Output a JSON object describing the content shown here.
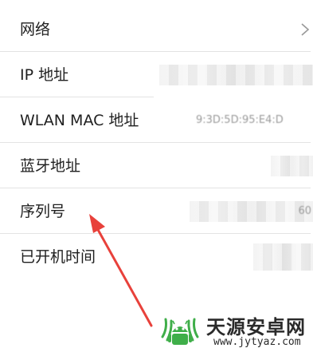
{
  "settings_rows": [
    {
      "label": "网络"
    },
    {
      "label": "IP 地址"
    },
    {
      "label": "WLAN MAC 地址",
      "visible_fragment": "9:3D:5D:95:E4:D"
    },
    {
      "label": "蓝牙地址"
    },
    {
      "label": "序列号",
      "visible_fragment": "60"
    },
    {
      "label": "已开机时间"
    }
  ],
  "annotation": {
    "color": "#e8413b",
    "points_to": "序列号"
  },
  "watermark": {
    "title": "天源安卓网",
    "url": "www.jytyaz.com",
    "logo_color": "#3fae49"
  },
  "icons": {
    "network_chevron": "chevron-right-icon"
  }
}
